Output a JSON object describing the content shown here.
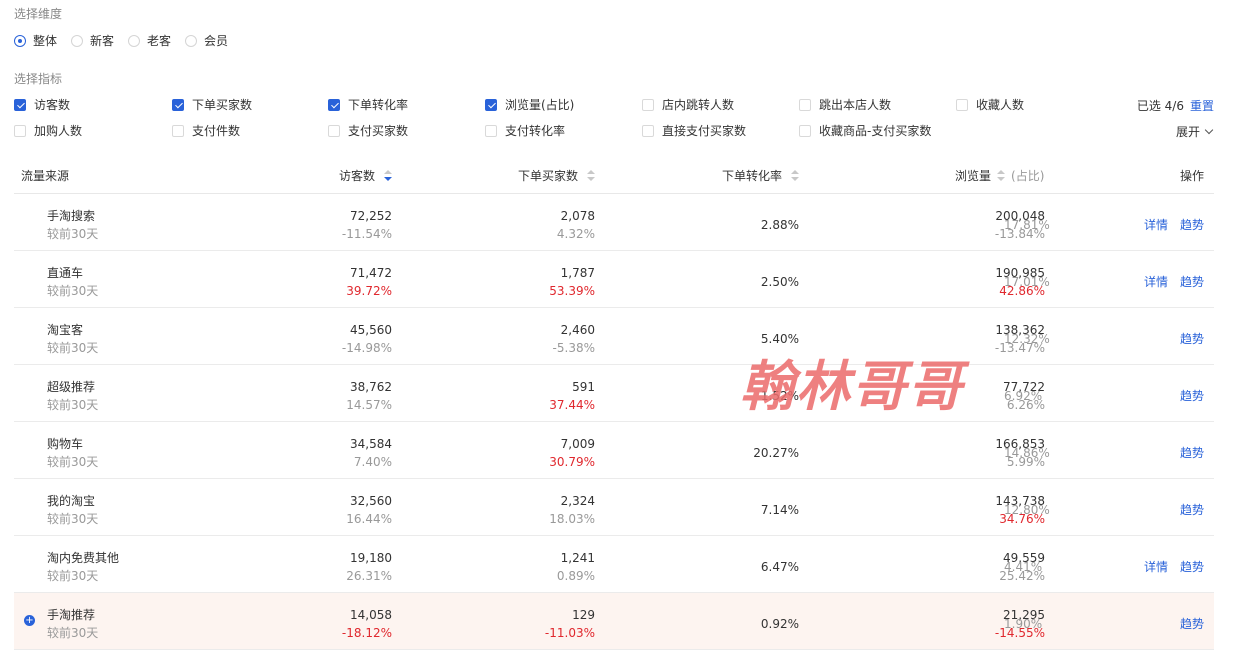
{
  "dimension": {
    "label": "选择维度",
    "options": [
      {
        "label": "整体",
        "selected": true
      },
      {
        "label": "新客",
        "selected": false
      },
      {
        "label": "老客",
        "selected": false
      },
      {
        "label": "会员",
        "selected": false
      }
    ]
  },
  "indicators": {
    "label": "选择指标",
    "row1": [
      {
        "label": "访客数",
        "checked": true
      },
      {
        "label": "下单买家数",
        "checked": true
      },
      {
        "label": "下单转化率",
        "checked": true
      },
      {
        "label": "浏览量(占比)",
        "checked": true
      },
      {
        "label": "店内跳转人数",
        "checked": false
      },
      {
        "label": "跳出本店人数",
        "checked": false
      },
      {
        "label": "收藏人数",
        "checked": false
      }
    ],
    "row2": [
      {
        "label": "加购人数",
        "checked": false
      },
      {
        "label": "支付件数",
        "checked": false
      },
      {
        "label": "支付买家数",
        "checked": false
      },
      {
        "label": "支付转化率",
        "checked": false
      },
      {
        "label": "直接支付买家数",
        "checked": false
      },
      {
        "label": "收藏商品-支付买家数",
        "checked": false
      }
    ],
    "selected_text": "已选 4/6",
    "reset_label": "重置",
    "expand_label": "展开"
  },
  "table": {
    "headers": {
      "source": "流量来源",
      "visitors": "访客数",
      "buyers": "下单买家数",
      "conversion": "下单转化率",
      "pageviews": "浏览量",
      "pageviews_sub": "(占比)",
      "actions": "操作"
    },
    "compare_label": "较前30天",
    "detail_label": "详情",
    "trend_label": "趋势",
    "rows": [
      {
        "name": "手淘搜索",
        "visitors": "72,252",
        "visitors_chg": "-11.54%",
        "visitors_red": false,
        "buyers": "2,078",
        "buyers_chg": "4.32%",
        "buyers_red": false,
        "conversion": "2.88%",
        "pv": "200,048",
        "pv_chg": "-13.84%",
        "pv_red": false,
        "share": "17.81%",
        "detail": true,
        "highlight": false
      },
      {
        "name": "直通车",
        "visitors": "71,472",
        "visitors_chg": "39.72%",
        "visitors_red": true,
        "buyers": "1,787",
        "buyers_chg": "53.39%",
        "buyers_red": true,
        "conversion": "2.50%",
        "pv": "190,985",
        "pv_chg": "42.86%",
        "pv_red": true,
        "share": "17.01%",
        "detail": true,
        "highlight": false
      },
      {
        "name": "淘宝客",
        "visitors": "45,560",
        "visitors_chg": "-14.98%",
        "visitors_red": false,
        "buyers": "2,460",
        "buyers_chg": "-5.38%",
        "buyers_red": false,
        "conversion": "5.40%",
        "pv": "138,362",
        "pv_chg": "-13.47%",
        "pv_red": false,
        "share": "12.32%",
        "detail": false,
        "highlight": false
      },
      {
        "name": "超级推荐",
        "visitors": "38,762",
        "visitors_chg": "14.57%",
        "visitors_red": false,
        "buyers": "591",
        "buyers_chg": "37.44%",
        "buyers_red": true,
        "conversion": "1.52%",
        "pv": "77,722",
        "pv_chg": "6.26%",
        "pv_red": false,
        "share": "6.92%",
        "detail": false,
        "highlight": false
      },
      {
        "name": "购物车",
        "visitors": "34,584",
        "visitors_chg": "7.40%",
        "visitors_red": false,
        "buyers": "7,009",
        "buyers_chg": "30.79%",
        "buyers_red": true,
        "conversion": "20.27%",
        "pv": "166,853",
        "pv_chg": "5.99%",
        "pv_red": false,
        "share": "14.86%",
        "detail": false,
        "highlight": false
      },
      {
        "name": "我的淘宝",
        "visitors": "32,560",
        "visitors_chg": "16.44%",
        "visitors_red": false,
        "buyers": "2,324",
        "buyers_chg": "18.03%",
        "buyers_red": false,
        "conversion": "7.14%",
        "pv": "143,738",
        "pv_chg": "34.76%",
        "pv_red": true,
        "share": "12.80%",
        "detail": false,
        "highlight": false
      },
      {
        "name": "淘内免费其他",
        "visitors": "19,180",
        "visitors_chg": "26.31%",
        "visitors_red": false,
        "buyers": "1,241",
        "buyers_chg": "0.89%",
        "buyers_red": false,
        "conversion": "6.47%",
        "pv": "49,559",
        "pv_chg": "25.42%",
        "pv_red": false,
        "share": "4.41%",
        "detail": true,
        "highlight": false
      },
      {
        "name": "手淘推荐",
        "visitors": "14,058",
        "visitors_chg": "-18.12%",
        "visitors_red": true,
        "buyers": "129",
        "buyers_chg": "-11.03%",
        "buyers_red": true,
        "conversion": "0.92%",
        "pv": "21,295",
        "pv_chg": "-14.55%",
        "pv_red": true,
        "share": "1.90%",
        "detail": false,
        "highlight": true
      }
    ]
  },
  "watermark": "翰林哥哥",
  "colors": {
    "accent": "#2962d9",
    "negative": "#e0282e",
    "highlight_row": "#fdf4f0"
  }
}
